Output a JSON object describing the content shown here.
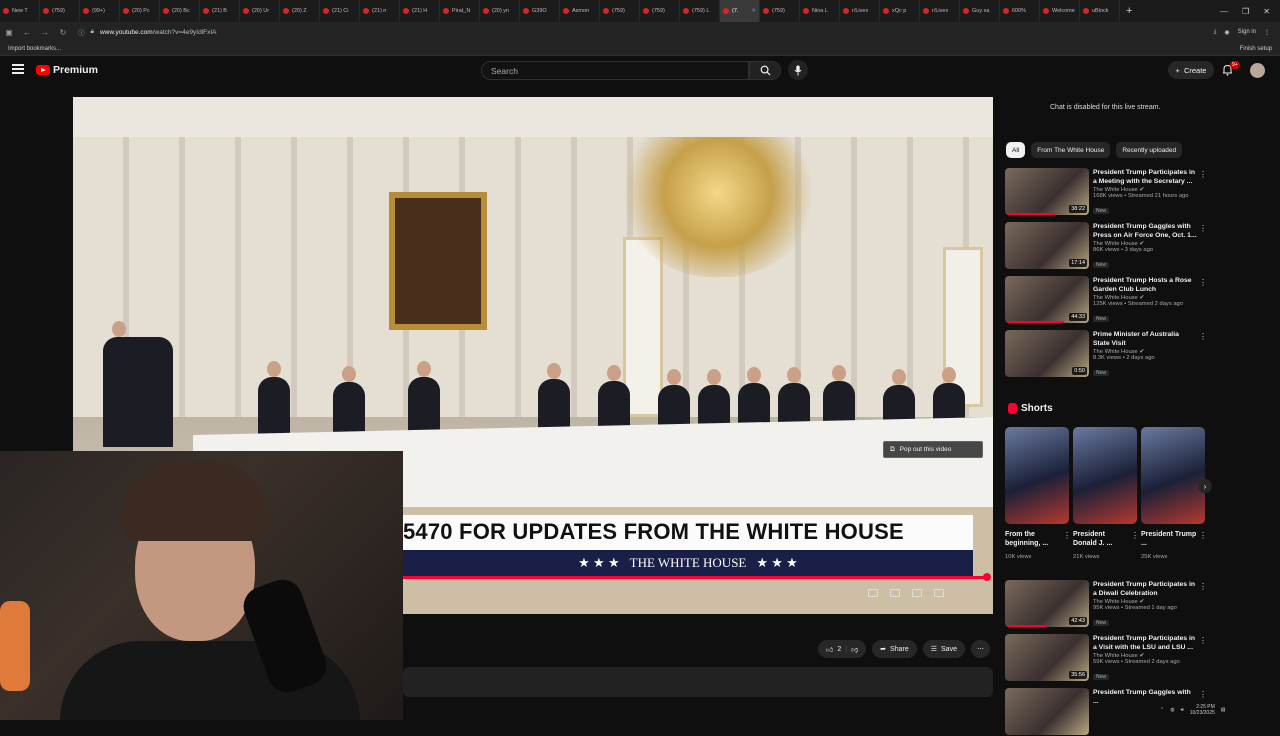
{
  "browser": {
    "tabs": [
      {
        "label": "New T"
      },
      {
        "label": "(759)"
      },
      {
        "label": "(99+)"
      },
      {
        "label": "(20) Pc"
      },
      {
        "label": "(20) Bc"
      },
      {
        "label": "(21) B"
      },
      {
        "label": "(20) Ur"
      },
      {
        "label": "(20) Z"
      },
      {
        "label": "(21) Ci"
      },
      {
        "label": "(21) n"
      },
      {
        "label": "(21) H"
      },
      {
        "label": "Pirat_N"
      },
      {
        "label": "(20) yn"
      },
      {
        "label": "G39O"
      },
      {
        "label": "Asmon"
      },
      {
        "label": "(759)"
      },
      {
        "label": "(759)"
      },
      {
        "label": "(759) L"
      },
      {
        "label": "(7."
      },
      {
        "label": "(759)"
      },
      {
        "label": "Nina L"
      },
      {
        "label": "r/Lives"
      },
      {
        "label": "xQc p"
      },
      {
        "label": "r/Lives"
      },
      {
        "label": "Guy sa"
      },
      {
        "label": "600%"
      },
      {
        "label": "Welcome"
      },
      {
        "label": "uBlock"
      }
    ],
    "active_tab_index": 18,
    "url_host": "www.youtube.com",
    "url_path": "/watch?v=4e9yIdlFxIA",
    "sign_in": "Sign in",
    "bookmarks_item": "Import bookmarks...",
    "finish_setup": "Finish setup"
  },
  "header": {
    "brand": "Premium",
    "search_placeholder": "Search",
    "create_label": "Create",
    "notif_count": "9+"
  },
  "video": {
    "banner_text": "5470 FOR UPDATES FROM THE WHITE HOUSE",
    "banner_sub": "THE WHITE HOUSE",
    "stars": "★ ★ ★",
    "popout_label": "Pop out this video"
  },
  "actions": {
    "likes": "2",
    "share": "Share",
    "save": "Save"
  },
  "sidebar": {
    "chat_disabled": "Chat is disabled for this live stream.",
    "chips": [
      "All",
      "From The White House",
      "Recently uploaded"
    ],
    "recs_top": [
      {
        "title": "President Trump Participates in a Meeting with the Secretary ...",
        "channel": "The White House",
        "meta": "168K views • Streamed 21 hours ago",
        "badge": "New",
        "duration": "38:22",
        "watched": 0.6
      },
      {
        "title": "President Trump Gaggles with Press on Air Force One, Oct. 1...",
        "channel": "The White House",
        "meta": "86K views • 3 days ago",
        "badge": "New",
        "duration": "17:14",
        "watched": 0.0
      },
      {
        "title": "President Trump Hosts a Rose Garden Club Lunch",
        "channel": "The White House",
        "meta": "125K views • Streamed 2 days ago",
        "badge": "New",
        "duration": "44:33",
        "watched": 0.7
      },
      {
        "title": "Prime Minister of Australia State Visit",
        "channel": "The White House",
        "meta": "8.3K views • 2 days ago",
        "badge": "New",
        "duration": "0:50",
        "watched": 0.0
      }
    ],
    "shorts_heading": "Shorts",
    "shorts": [
      {
        "title": "From the beginning, ...",
        "views": "10K views"
      },
      {
        "title": "President Donald J. ...",
        "views": "21K views"
      },
      {
        "title": "President Trump ...",
        "views": "25K views"
      }
    ],
    "recs_bottom": [
      {
        "title": "President Trump Participates in a Diwali Celebration",
        "channel": "The White House",
        "meta": "95K views • Streamed 1 day ago",
        "badge": "New",
        "duration": "42:43",
        "watched": 0.5
      },
      {
        "title": "President Trump Participates in a Visit with the LSU and LSU ...",
        "channel": "The White House",
        "meta": "59K views • Streamed 2 days ago",
        "badge": "New",
        "duration": "35:56",
        "watched": 0.0
      },
      {
        "title": "President Trump Gaggles with ...",
        "channel": "",
        "meta": "",
        "badge": "",
        "duration": "",
        "watched": 0.0
      }
    ]
  },
  "taskbar": {
    "time": "2:25 PM",
    "date": "10/23/2025"
  }
}
